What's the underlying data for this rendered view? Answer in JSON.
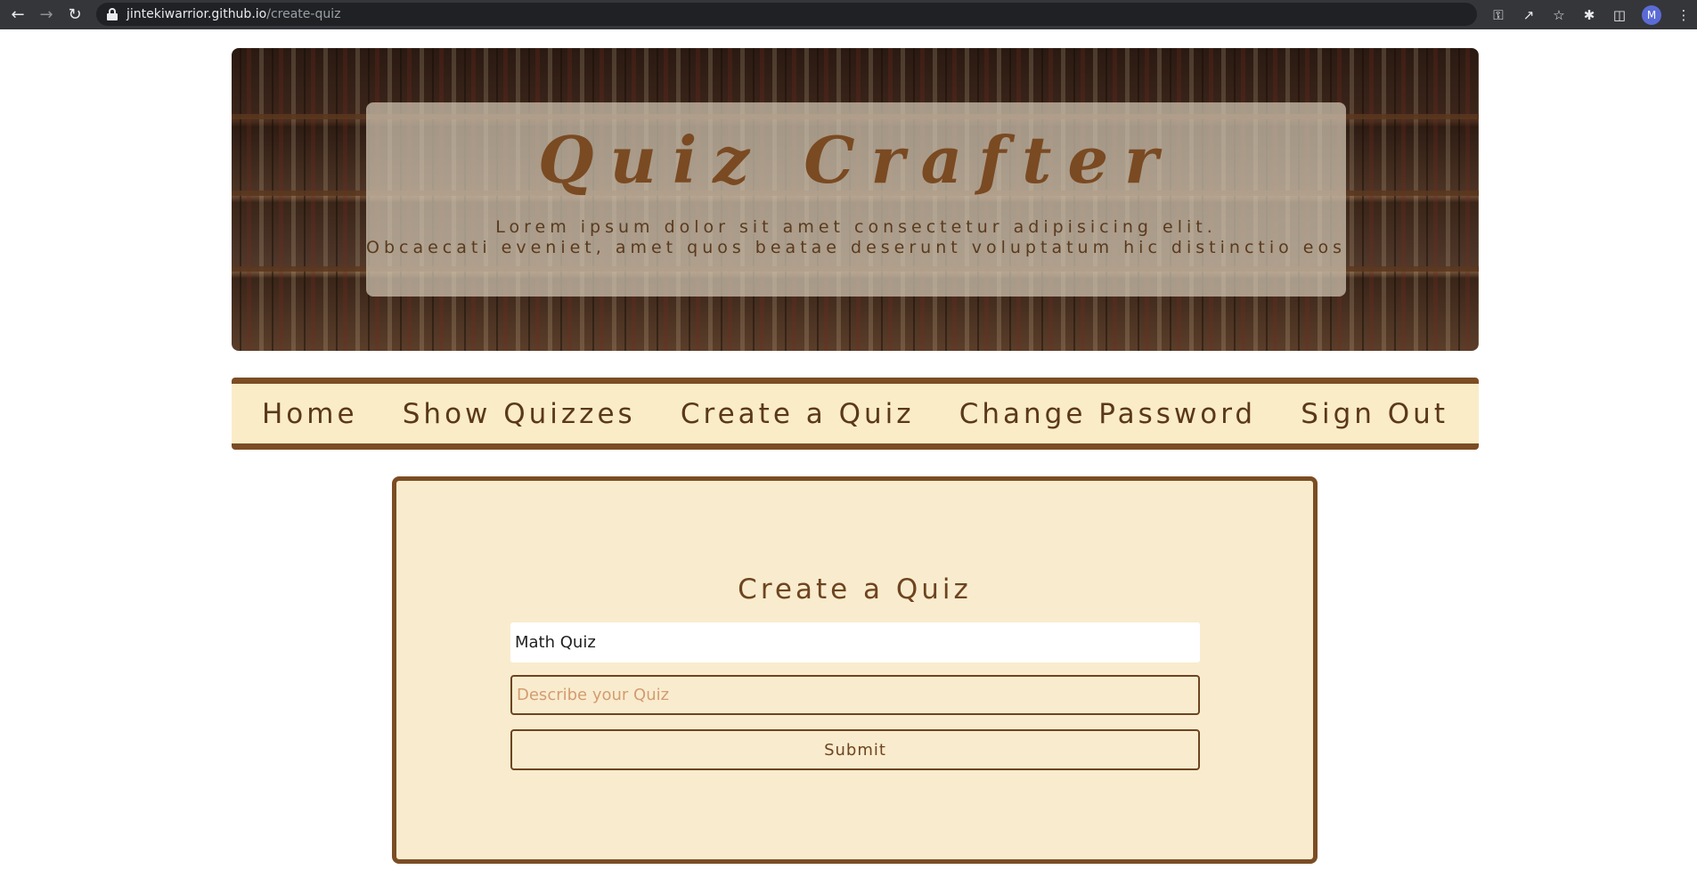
{
  "browser": {
    "url_host": "jintekiwarrior.github.io",
    "url_path": "/create-quiz",
    "profile_initial": "M"
  },
  "hero": {
    "title": "Quiz Crafter",
    "subtitle_line1": "Lorem ipsum dolor sit amet consectetur adipisicing elit.",
    "subtitle_line2": "Obcaecati eveniet, amet quos beatae deserunt voluptatum hic distinctio eos"
  },
  "nav": {
    "items": [
      {
        "label": "Home"
      },
      {
        "label": "Show Quizzes"
      },
      {
        "label": "Create a Quiz"
      },
      {
        "label": "Change Password"
      },
      {
        "label": "Sign Out"
      }
    ]
  },
  "form": {
    "heading": "Create a Quiz",
    "title_value": "Math Quiz",
    "description_value": "",
    "description_placeholder": "Describe your Quiz",
    "submit_label": "Submit"
  },
  "colors": {
    "brown": "#7b4d24",
    "cream": "#f9ecce",
    "nav_bg": "#fbecc8",
    "placeholder": "#d29c72"
  }
}
